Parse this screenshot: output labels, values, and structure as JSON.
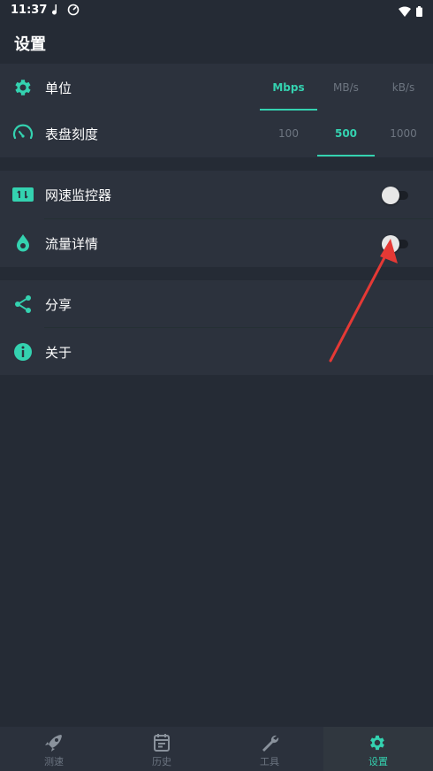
{
  "status_bar": {
    "time": "11:37"
  },
  "header": {
    "title": "设置"
  },
  "settings": {
    "unit": {
      "label": "单位",
      "options": [
        "Mbps",
        "MB/s",
        "kB/s"
      ],
      "selected": "Mbps"
    },
    "dial": {
      "label": "表盘刻度",
      "options": [
        "100",
        "500",
        "1000"
      ],
      "selected": "500"
    },
    "speed_monitor": {
      "label": "网速监控器",
      "enabled": false
    },
    "traffic_details": {
      "label": "流量详情",
      "enabled": false
    },
    "share": {
      "label": "分享"
    },
    "about": {
      "label": "关于"
    }
  },
  "bottom_nav": {
    "items": [
      {
        "label": "测速",
        "icon": "rocket-icon"
      },
      {
        "label": "历史",
        "icon": "calendar-icon"
      },
      {
        "label": "工具",
        "icon": "wrench-icon"
      },
      {
        "label": "设置",
        "icon": "gear-icon"
      }
    ],
    "active": "设置"
  },
  "colors": {
    "accent": "#34d2b0",
    "background": "#252b35",
    "card": "#2c323d",
    "annotation_arrow": "#e53935"
  }
}
